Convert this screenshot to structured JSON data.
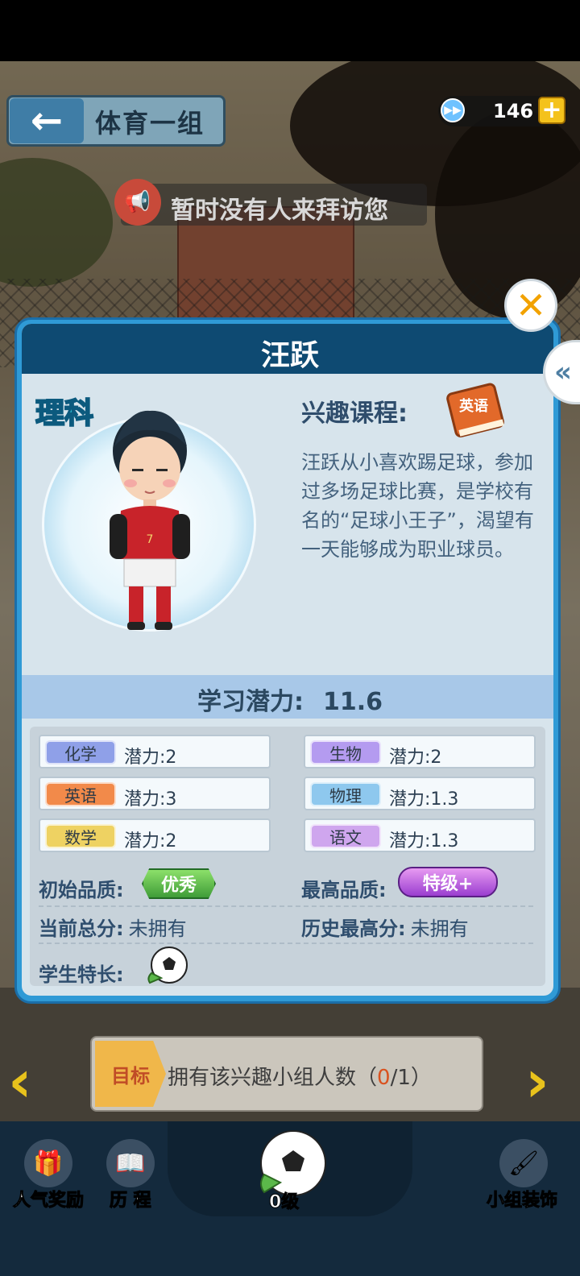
{
  "header": {
    "back_icon": "←",
    "group_title": "体育一组",
    "currency_value": "146",
    "currency_plus": "+"
  },
  "notice": {
    "text": "暂时没有人来拜访您"
  },
  "dialog": {
    "title": "汪跃",
    "subject_tag": "理科",
    "interest_label": "兴趣课程:",
    "interest_book_text": "英语",
    "bio": "汪跃从小喜欢踢足球，参加过多场足球比赛，是学校有名的“足球小王子”，渴望有一天能够成为职业球员。",
    "potential_label": "学习潜力:",
    "potential_value": "11.6",
    "close_icon": "✕",
    "side_tab_icon": "«"
  },
  "stats": [
    {
      "subject": "化学",
      "value": "潜力:2",
      "color": "#8fa0e8"
    },
    {
      "subject": "生物",
      "value": "潜力:2",
      "color": "#b49bf0"
    },
    {
      "subject": "英语",
      "value": "潜力:3",
      "color": "#f28a4a"
    },
    {
      "subject": "物理",
      "value": "潜力:1.3",
      "color": "#8ec8ee"
    },
    {
      "subject": "数学",
      "value": "潜力:2",
      "color": "#eed262"
    },
    {
      "subject": "语文",
      "value": "潜力:1.3",
      "color": "#cfa6ee"
    }
  ],
  "quality": {
    "initial_label": "初始品质:",
    "initial_badge": "优秀",
    "max_label": "最高品质:",
    "max_badge": "特级+",
    "current_score_label": "当前总分:",
    "current_score_value": "未拥有",
    "best_score_label": "历史最高分:",
    "best_score_value": "未拥有",
    "specialty_label": "学生特长:"
  },
  "goal": {
    "tag": "目标",
    "text_prefix": "拥有该兴趣小组人数（",
    "current": "0",
    "text_suffix": "/1）"
  },
  "bottom_nav": {
    "popularity_reward": "人气奖励",
    "history": "历 程",
    "level": "0级",
    "group_decoration": "小组装饰"
  }
}
